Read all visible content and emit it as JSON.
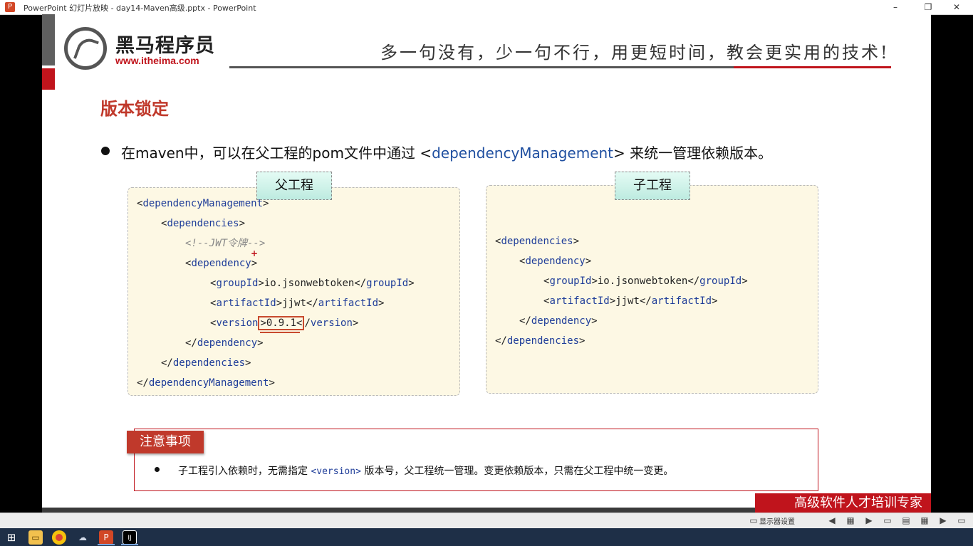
{
  "window": {
    "title": "PowerPoint 幻灯片放映  -  day14-Maven高级.pptx - PowerPoint",
    "app_icon": "P",
    "controls": {
      "minimize": "–",
      "restore": "❐",
      "close": "✕"
    }
  },
  "slide": {
    "logo": {
      "name": "黑马程序员",
      "url": "www.itheima.com"
    },
    "slogan": "多一句没有，少一句不行，用更短时间，教会更实用的技术!",
    "heading": "版本锁定",
    "bullet": {
      "before": "在maven中，可以在父工程的pom文件中通过 <",
      "keyword": "dependencyManagement",
      "after": "> 来统一管理依赖版本。"
    },
    "parent": {
      "tag": "父工程",
      "lines": {
        "l1_open": "<",
        "l1_tag": "dependencyManagement",
        "l1_close": ">",
        "l2_open": "<",
        "l2_tag": "dependencies",
        "l2_close": ">",
        "l3_comment": "<!--JWT令牌-->",
        "l4_open": "<",
        "l4_tag": "dependency",
        "l4_close": ">",
        "l5_open": "<",
        "l5_tag": "groupId",
        "l5_mid": ">io.jsonwebtoken</",
        "l5_tag2": "groupId",
        "l5_close": ">",
        "l6_open": "<",
        "l6_tag": "artifactId",
        "l6_mid": ">jjwt</",
        "l6_tag2": "artifactId",
        "l6_close": ">",
        "l7_open": "<",
        "l7_tag": "version",
        "l7_value": ">0.9.1<",
        "l7_mid": "/",
        "l7_tag2": "version",
        "l7_close": ">",
        "l8_open": "</",
        "l8_tag": "dependency",
        "l8_close": ">",
        "l9_open": "</",
        "l9_tag": "dependencies",
        "l9_close": ">",
        "l10_open": "</",
        "l10_tag": "dependencyManagement",
        "l10_close": ">"
      }
    },
    "child": {
      "tag": "子工程",
      "lines": {
        "l1_open": "<",
        "l1_tag": "dependencies",
        "l1_close": ">",
        "l2_open": "<",
        "l2_tag": "dependency",
        "l2_close": ">",
        "l3_open": "<",
        "l3_tag": "groupId",
        "l3_mid": ">io.jsonwebtoken</",
        "l3_tag2": "groupId",
        "l3_close": ">",
        "l4_open": "<",
        "l4_tag": "artifactId",
        "l4_mid": ">jjwt</",
        "l4_tag2": "artifactId",
        "l4_close": ">",
        "l5_open": "</",
        "l5_tag": "dependency",
        "l5_close": ">",
        "l6_open": "</",
        "l6_tag": "dependencies",
        "l6_close": ">"
      }
    },
    "notes": {
      "tag": "注意事项",
      "before": "子工程引入依赖时，无需指定 ",
      "code": "<version>",
      "after": " 版本号，父工程统一管理。变更依赖版本，只需在父工程中统一变更。"
    },
    "brand_banner": "高级软件人才培训专家"
  },
  "presenter_bar": {
    "display_settings": "显示器设置",
    "buttons": [
      "◀",
      "▦",
      "▶",
      "▭",
      "▤",
      "▦",
      "▶",
      "▭"
    ]
  },
  "taskbar": {
    "icons": [
      "windows-start",
      "file-explorer",
      "chrome",
      "network",
      "powerpoint",
      "intellij"
    ]
  },
  "colors": {
    "accent_red": "#c0141c",
    "tag_blue": "#1f3d99",
    "box_fill": "#fdf8e4"
  }
}
